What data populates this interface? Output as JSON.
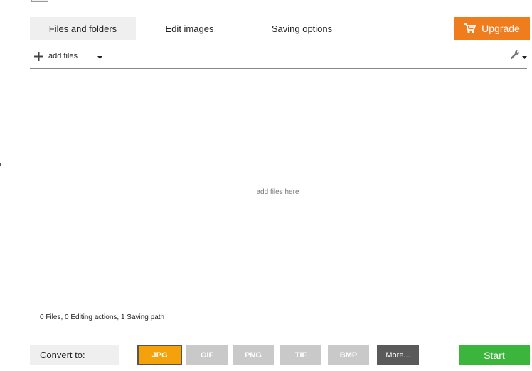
{
  "tabs": [
    {
      "label": "Files and folders",
      "active": true
    },
    {
      "label": "Edit images",
      "active": false
    },
    {
      "label": "Saving options",
      "active": false
    }
  ],
  "upgrade": {
    "label": "Upgrade",
    "icon": "cart-icon",
    "color": "#f07d1d"
  },
  "toolbar": {
    "add_files_label": "add files",
    "add_icon": "plus-icon",
    "caret_icon": "caret-down-icon",
    "settings_icon": "wrench-icon"
  },
  "dropzone": {
    "hint": "add files here"
  },
  "status": {
    "text": "0 Files, 0 Editing actions, 1 Saving path"
  },
  "convert": {
    "label": "Convert to:",
    "formats": [
      {
        "label": "JPG",
        "selected": true
      },
      {
        "label": "GIF",
        "selected": false
      },
      {
        "label": "PNG",
        "selected": false
      },
      {
        "label": "TIF",
        "selected": false
      },
      {
        "label": "BMP",
        "selected": false
      }
    ],
    "more_label": "More..."
  },
  "start": {
    "label": "Start",
    "color": "#3bb53b"
  },
  "colors": {
    "accent_orange": "#f07d1d",
    "selected_format": "#f5a10a",
    "start_green": "#3bb53b"
  }
}
